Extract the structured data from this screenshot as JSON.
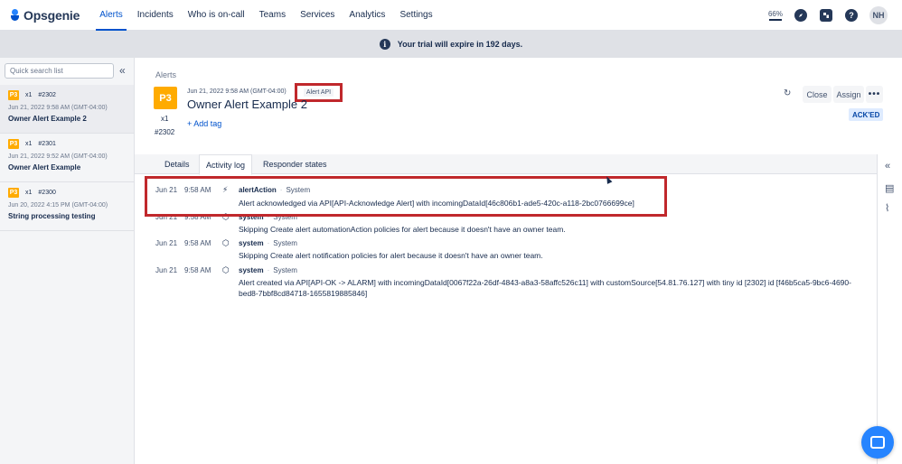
{
  "app": {
    "name": "Opsgenie"
  },
  "nav": {
    "items": [
      "Alerts",
      "Incidents",
      "Who is on-call",
      "Teams",
      "Services",
      "Analytics",
      "Settings"
    ],
    "zoom": "66%",
    "help": "?",
    "avatar": "NH"
  },
  "banner": {
    "text": "Your trial will expire in 192 days."
  },
  "sidebar": {
    "search_placeholder": "Quick search list",
    "collapse": "«",
    "alerts": [
      {
        "priority": "P3",
        "count": "x1",
        "number": "#2302",
        "date": "Jun 21, 2022 9:58 AM (GMT-04:00)",
        "title": "Owner Alert Example 2"
      },
      {
        "priority": "P3",
        "count": "x1",
        "number": "#2301",
        "date": "Jun 21, 2022 9:52 AM (GMT-04:00)",
        "title": "Owner Alert Example"
      },
      {
        "priority": "P3",
        "count": "x1",
        "number": "#2300",
        "date": "Jun 20, 2022 4:15 PM (GMT-04:00)",
        "title": "String processing testing"
      }
    ]
  },
  "detail": {
    "breadcrumb": "Alerts",
    "priority": "P3",
    "count": "x1",
    "number": "#2302",
    "date": "Jun 21, 2022 9:58 AM (GMT-04:00)",
    "source_badge": "Alert API",
    "title": "Owner Alert Example 2",
    "add_tag": "+ Add tag",
    "buttons": {
      "refresh": "↻",
      "close": "Close",
      "assign": "Assign",
      "more": "•••"
    },
    "status": "ACK'ED"
  },
  "tabs": [
    "Details",
    "Activity log",
    "Responder states"
  ],
  "active_tab": "Activity log",
  "rail": {
    "expand": "«",
    "notes": "▤",
    "attach": "⌇"
  },
  "activity_log": [
    {
      "date": "Jun 21",
      "time": "9:58 AM",
      "icon": "⚡",
      "actor": "alertAction",
      "source": "System",
      "message": "Alert acknowledged via API[API-Acknowledge Alert] with incomingDataId[46c806b1-ade5-420c-a118-2bc0766699ce]"
    },
    {
      "date": "Jun 21",
      "time": "9:58 AM",
      "icon": "⬡",
      "actor": "system",
      "source": "System",
      "message": "Skipping Create alert automationAction policies for alert because it doesn't have an owner team."
    },
    {
      "date": "Jun 21",
      "time": "9:58 AM",
      "icon": "⬡",
      "actor": "system",
      "source": "System",
      "message": "Skipping Create alert notification policies for alert because it doesn't have an owner team."
    },
    {
      "date": "Jun 21",
      "time": "9:58 AM",
      "icon": "⬡",
      "actor": "system",
      "source": "System",
      "message": "Alert created via API[API-OK -> ALARM] with incomingDataId[0067f22a-26df-4843-a8a3-58affc526c11] with customSource[54.81.76.127] with tiny id [2302] id [f46b5ca5-9bc6-4690-bed8-7bbf8cd84718-1655819885846]"
    }
  ],
  "colors": {
    "accent": "#0052cc",
    "priority_p3": "#ffab00",
    "highlight": "#c0282c",
    "acked_bg": "#deebff"
  }
}
